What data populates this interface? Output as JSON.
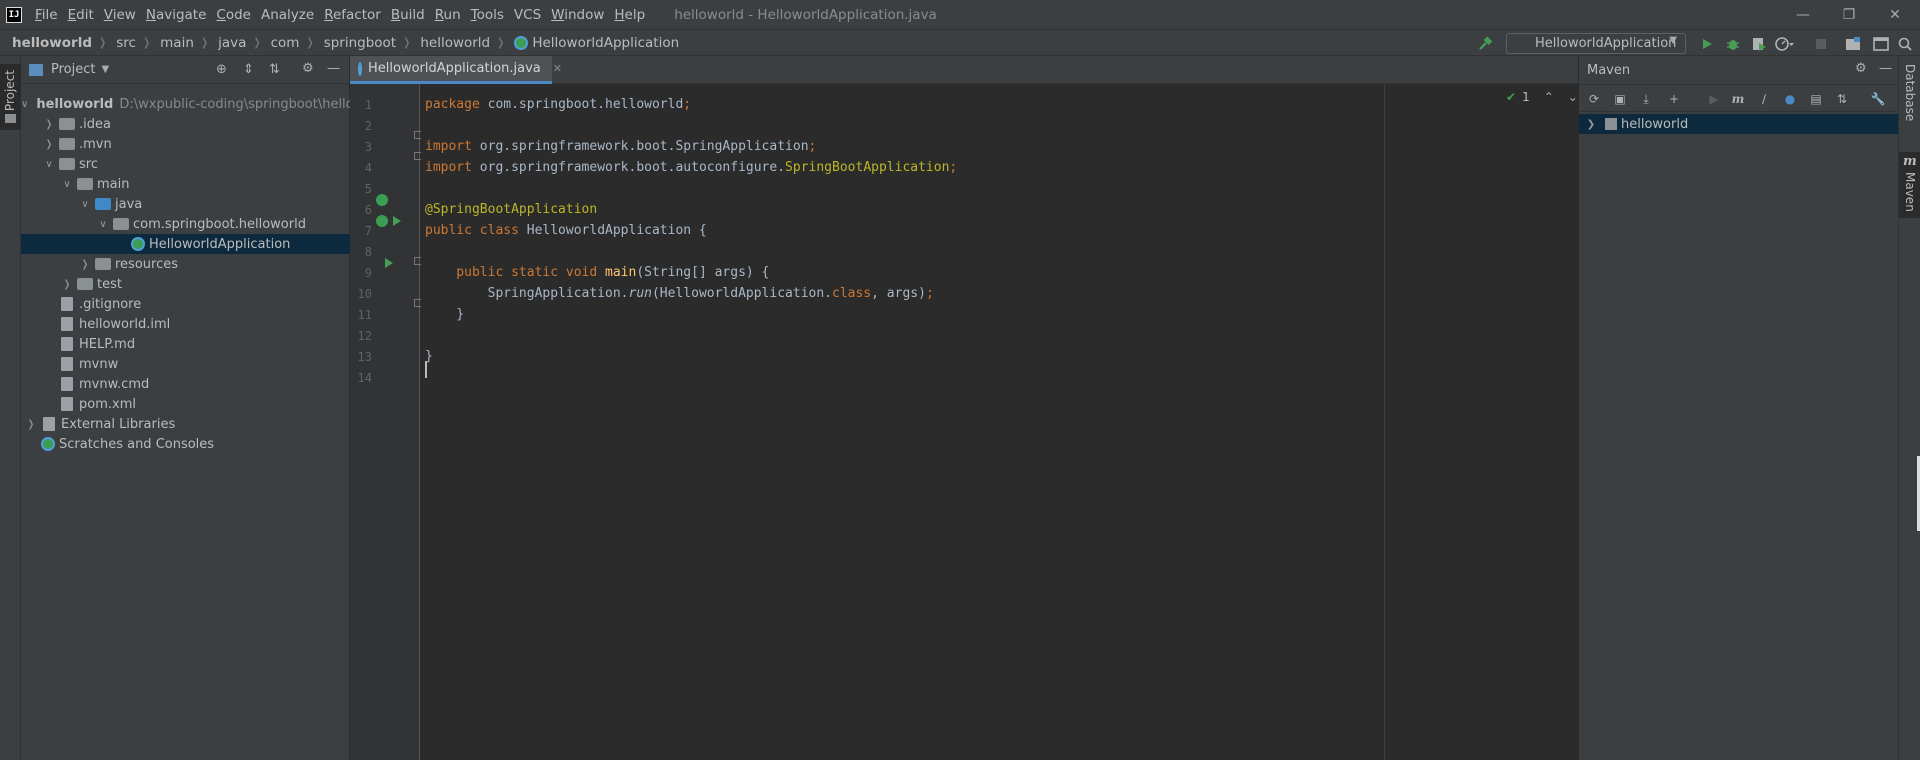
{
  "menubar": {
    "items": [
      {
        "mnemonic": "F",
        "rest": "ile"
      },
      {
        "mnemonic": "E",
        "rest": "dit"
      },
      {
        "mnemonic": "V",
        "rest": "iew"
      },
      {
        "mnemonic": "N",
        "rest": "avigate"
      },
      {
        "mnemonic": "C",
        "rest": "ode"
      },
      {
        "mnemonic": "",
        "rest": "Analyze"
      },
      {
        "mnemonic": "R",
        "rest": "efactor"
      },
      {
        "mnemonic": "B",
        "rest": "uild"
      },
      {
        "mnemonic": "R",
        "rest": "un"
      },
      {
        "mnemonic": "T",
        "rest": "ools"
      },
      {
        "mnemonic": "",
        "rest": "VCS"
      },
      {
        "mnemonic": "W",
        "rest": "indow"
      },
      {
        "mnemonic": "H",
        "rest": "elp"
      }
    ],
    "window_title": "helloworld - HelloworldApplication.java",
    "logo_text": "IJ"
  },
  "navbar": {
    "breadcrumbs": [
      "helloworld",
      "src",
      "main",
      "java",
      "com",
      "springboot",
      "helloworld",
      "HelloworldApplication"
    ],
    "run_config": "HelloworldApplication"
  },
  "left_stripe": {
    "project_label": "Project"
  },
  "project": {
    "header_title": "Project",
    "tree": [
      {
        "label": "helloworld",
        "path": "D:\\wxpublic-coding\\springboot\\hello",
        "level": 0,
        "expanded": true,
        "icon": "module"
      },
      {
        "label": ".idea",
        "level": 1,
        "expanded": false,
        "icon": "folder"
      },
      {
        "label": ".mvn",
        "level": 1,
        "expanded": false,
        "icon": "folder"
      },
      {
        "label": "src",
        "level": 1,
        "expanded": true,
        "icon": "folder"
      },
      {
        "label": "main",
        "level": 2,
        "expanded": true,
        "icon": "folder"
      },
      {
        "label": "java",
        "level": 3,
        "expanded": true,
        "icon": "folder-blue"
      },
      {
        "label": "com.springboot.helloworld",
        "level": 4,
        "expanded": true,
        "icon": "package"
      },
      {
        "label": "HelloworldApplication",
        "level": 5,
        "icon": "spring-class",
        "selected": true
      },
      {
        "label": "resources",
        "level": 3,
        "expanded": false,
        "icon": "folder"
      },
      {
        "label": "test",
        "level": 2,
        "expanded": false,
        "icon": "folder"
      },
      {
        "label": ".gitignore",
        "level": 1,
        "icon": "file"
      },
      {
        "label": "helloworld.iml",
        "level": 1,
        "icon": "file"
      },
      {
        "label": "HELP.md",
        "level": 1,
        "icon": "file"
      },
      {
        "label": "mvnw",
        "level": 1,
        "icon": "file"
      },
      {
        "label": "mvnw.cmd",
        "level": 1,
        "icon": "file"
      },
      {
        "label": "pom.xml",
        "level": 1,
        "icon": "maven-file"
      },
      {
        "label": "External Libraries",
        "level": 0,
        "expanded": false,
        "icon": "libraries"
      },
      {
        "label": "Scratches and Consoles",
        "level": 0,
        "icon": "scratches"
      }
    ]
  },
  "editor": {
    "tab_label": "HelloworldApplication.java",
    "inspection_count": "1",
    "line_numbers": [
      "1",
      "2",
      "3",
      "4",
      "5",
      "6",
      "7",
      "8",
      "9",
      "10",
      "11",
      "12",
      "13",
      "14"
    ],
    "lines": [
      [
        {
          "t": "package",
          "c": "kw"
        },
        {
          "t": " com.springboot.helloworld",
          "c": ""
        },
        {
          "t": ";",
          "c": "kw"
        }
      ],
      [],
      [
        {
          "t": "import",
          "c": "kw"
        },
        {
          "t": " org.springframework.boot.SpringApplication",
          "c": ""
        },
        {
          "t": ";",
          "c": "kw"
        }
      ],
      [
        {
          "t": "import",
          "c": "kw"
        },
        {
          "t": " org.springframework.boot.autoconfigure.",
          "c": ""
        },
        {
          "t": "SpringBootApplication",
          "c": "ann"
        },
        {
          "t": ";",
          "c": "kw"
        }
      ],
      [],
      [
        {
          "t": "@SpringBootApplication",
          "c": "ann"
        }
      ],
      [
        {
          "t": "public class",
          "c": "kw"
        },
        {
          "t": " HelloworldApplication {",
          "c": ""
        }
      ],
      [],
      [
        {
          "t": "    public static void",
          "c": "kw"
        },
        {
          "t": " ",
          "c": ""
        },
        {
          "t": "main",
          "c": "fn"
        },
        {
          "t": "(String[] args) {",
          "c": ""
        }
      ],
      [
        {
          "t": "        SpringApplication.",
          "c": ""
        },
        {
          "t": "run",
          "c": "it"
        },
        {
          "t": "(HelloworldApplication.",
          "c": ""
        },
        {
          "t": "class",
          "c": "kw"
        },
        {
          "t": ", args)",
          "c": ""
        },
        {
          "t": ";",
          "c": "kw"
        }
      ],
      [
        {
          "t": "    }",
          "c": ""
        }
      ],
      [],
      [
        {
          "t": "}",
          "c": ""
        }
      ],
      []
    ]
  },
  "maven": {
    "header_title": "Maven",
    "root_project": "helloworld"
  },
  "right_stripe": {
    "database_label": "Database",
    "maven_label": "Maven"
  },
  "colors": {
    "accent": "#4a88c7",
    "selection": "#0d293e",
    "run_green": "#499c54",
    "arrow_red": "#e8202a"
  }
}
